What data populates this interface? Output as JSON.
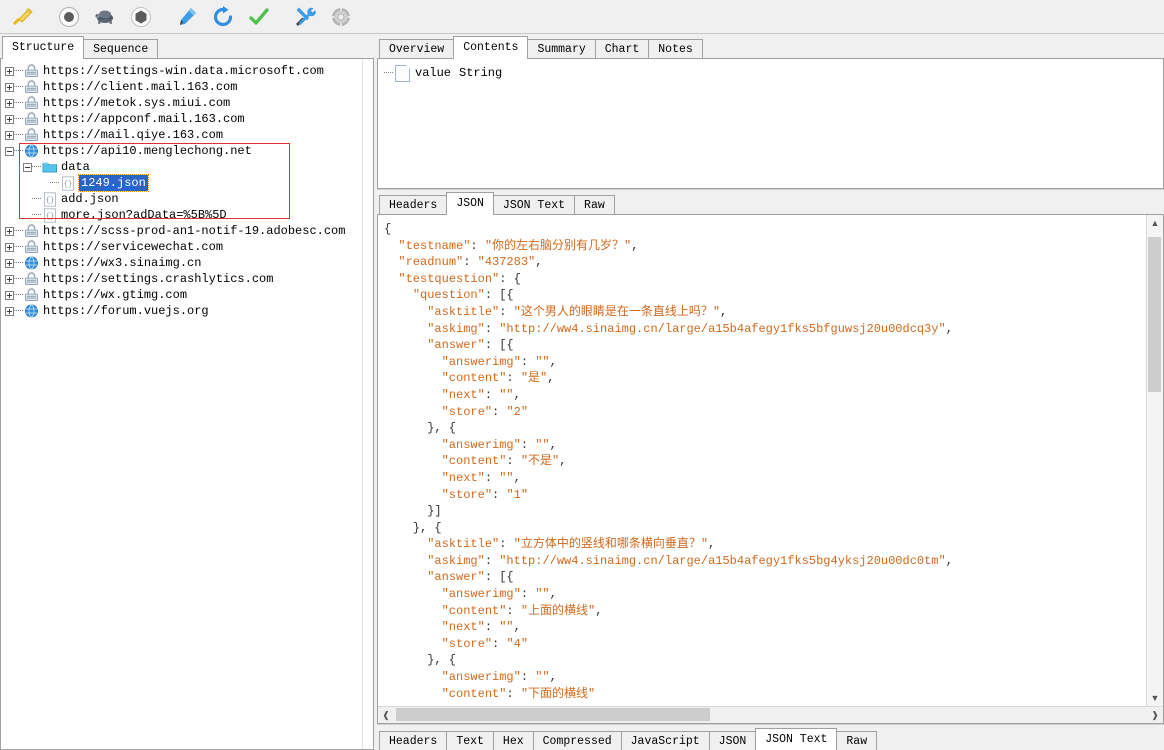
{
  "toolbar": {
    "buttons": [
      {
        "name": "clear-session-button",
        "icon": "broom-icon",
        "title": "Clear"
      },
      {
        "name": "record-button",
        "icon": "record-circle-icon",
        "title": "Record"
      },
      {
        "name": "throttle-button",
        "icon": "turtle-icon",
        "title": "Throttling"
      },
      {
        "name": "stop-button",
        "icon": "hexagon-icon",
        "title": "Stop"
      },
      {
        "name": "compose-button",
        "icon": "pen-icon",
        "title": "Compose"
      },
      {
        "name": "repeat-button",
        "icon": "refresh-icon",
        "title": "Repeat"
      },
      {
        "name": "validate-button",
        "icon": "checkmark-icon",
        "title": "Validate"
      },
      {
        "name": "tools-button",
        "icon": "tools-icon",
        "title": "Tools"
      },
      {
        "name": "settings-button",
        "icon": "gear-icon",
        "title": "Settings"
      }
    ]
  },
  "left_panel": {
    "tabs": [
      {
        "label": "Structure",
        "active": true
      },
      {
        "label": "Sequence",
        "active": false
      }
    ],
    "tree": [
      {
        "label": "https://settings-win.data.microsoft.com",
        "indent": 0,
        "toggle": "plus",
        "icon": "lock-host-icon"
      },
      {
        "label": "https://client.mail.163.com",
        "indent": 0,
        "toggle": "plus",
        "icon": "lock-host-icon"
      },
      {
        "label": "https://metok.sys.miui.com",
        "indent": 0,
        "toggle": "plus",
        "icon": "lock-host-icon"
      },
      {
        "label": "https://appconf.mail.163.com",
        "indent": 0,
        "toggle": "plus",
        "icon": "lock-host-icon"
      },
      {
        "label": "https://mail.qiye.163.com",
        "indent": 0,
        "toggle": "plus",
        "icon": "lock-host-icon"
      },
      {
        "label": "https://api10.menglechong.net",
        "indent": 0,
        "toggle": "minus",
        "icon": "globe-host-icon"
      },
      {
        "label": "data",
        "indent": 1,
        "toggle": "minus",
        "icon": "folder-icon"
      },
      {
        "label": "1249.json",
        "indent": 2,
        "toggle": "none",
        "icon": "json-file-icon",
        "selected": true
      },
      {
        "label": "add.json",
        "indent": 1,
        "toggle": "none",
        "icon": "json-file-icon"
      },
      {
        "label": "more.json?adData=%5B%5D",
        "indent": 1,
        "toggle": "none",
        "icon": "json-file-icon"
      },
      {
        "label": "https://scss-prod-an1-notif-19.adobesc.com",
        "indent": 0,
        "toggle": "plus",
        "icon": "lock-host-icon"
      },
      {
        "label": "https://servicewechat.com",
        "indent": 0,
        "toggle": "plus",
        "icon": "lock-host-icon"
      },
      {
        "label": "https://wx3.sinaimg.cn",
        "indent": 0,
        "toggle": "plus",
        "icon": "globe-host-icon"
      },
      {
        "label": "https://settings.crashlytics.com",
        "indent": 0,
        "toggle": "plus",
        "icon": "lock-host-icon"
      },
      {
        "label": "https://wx.gtimg.com",
        "indent": 0,
        "toggle": "plus",
        "icon": "lock-host-icon"
      },
      {
        "label": "https://forum.vuejs.org",
        "indent": 0,
        "toggle": "plus",
        "icon": "globe-host-icon"
      }
    ]
  },
  "right_panel": {
    "top_tabs": [
      {
        "label": "Overview",
        "active": false
      },
      {
        "label": "Contents",
        "active": true
      },
      {
        "label": "Summary",
        "active": false
      },
      {
        "label": "Chart",
        "active": false
      },
      {
        "label": "Notes",
        "active": false
      }
    ],
    "upper_tree": {
      "name": "value",
      "type": "String"
    },
    "request_tabs": [
      {
        "label": "Headers",
        "active": false
      },
      {
        "label": "JSON",
        "active": true
      },
      {
        "label": "JSON Text",
        "active": false
      },
      {
        "label": "Raw",
        "active": false
      }
    ],
    "response_tabs": [
      {
        "label": "Headers",
        "active": false
      },
      {
        "label": "Text",
        "active": false
      },
      {
        "label": "Hex",
        "active": false
      },
      {
        "label": "Compressed",
        "active": false
      },
      {
        "label": "JavaScript",
        "active": false
      },
      {
        "label": "JSON",
        "active": false
      },
      {
        "label": "JSON Text",
        "active": true
      },
      {
        "label": "Raw",
        "active": false
      }
    ],
    "json_lines": [
      "{",
      "  \"testname\": \"你的左右脑分别有几岁？\",",
      "  \"readnum\": \"437283\",",
      "  \"testquestion\": {",
      "    \"question\": [{",
      "      \"asktitle\": \"这个男人的眼睛是在一条直线上吗？\",",
      "      \"askimg\": \"http://ww4.sinaimg.cn/large/a15b4afegy1fks5bfguwsj20u00dcq3y\",",
      "      \"answer\": [{",
      "        \"answerimg\": \"\",",
      "        \"content\": \"是\",",
      "        \"next\": \"\",",
      "        \"store\": \"2\"",
      "      }, {",
      "        \"answerimg\": \"\",",
      "        \"content\": \"不是\",",
      "        \"next\": \"\",",
      "        \"store\": \"1\"",
      "      }]",
      "    }, {",
      "      \"asktitle\": \"立方体中的竖线和哪条横向垂直？\",",
      "      \"askimg\": \"http://ww4.sinaimg.cn/large/a15b4afegy1fks5bg4yksj20u00dc0tm\",",
      "      \"answer\": [{",
      "        \"answerimg\": \"\",",
      "        \"content\": \"上面的横线\",",
      "        \"next\": \"\",",
      "        \"store\": \"4\"",
      "      }, {",
      "        \"answerimg\": \"\",",
      "        \"content\": \"下面的横线\""
    ]
  },
  "colors": {
    "selection_blue": "#2a64c8",
    "focus_orange": "#ff8c00",
    "json_string": "#d2691e",
    "highlight_box_red": "#e03030",
    "panel_bg": "#f0f0f0"
  }
}
